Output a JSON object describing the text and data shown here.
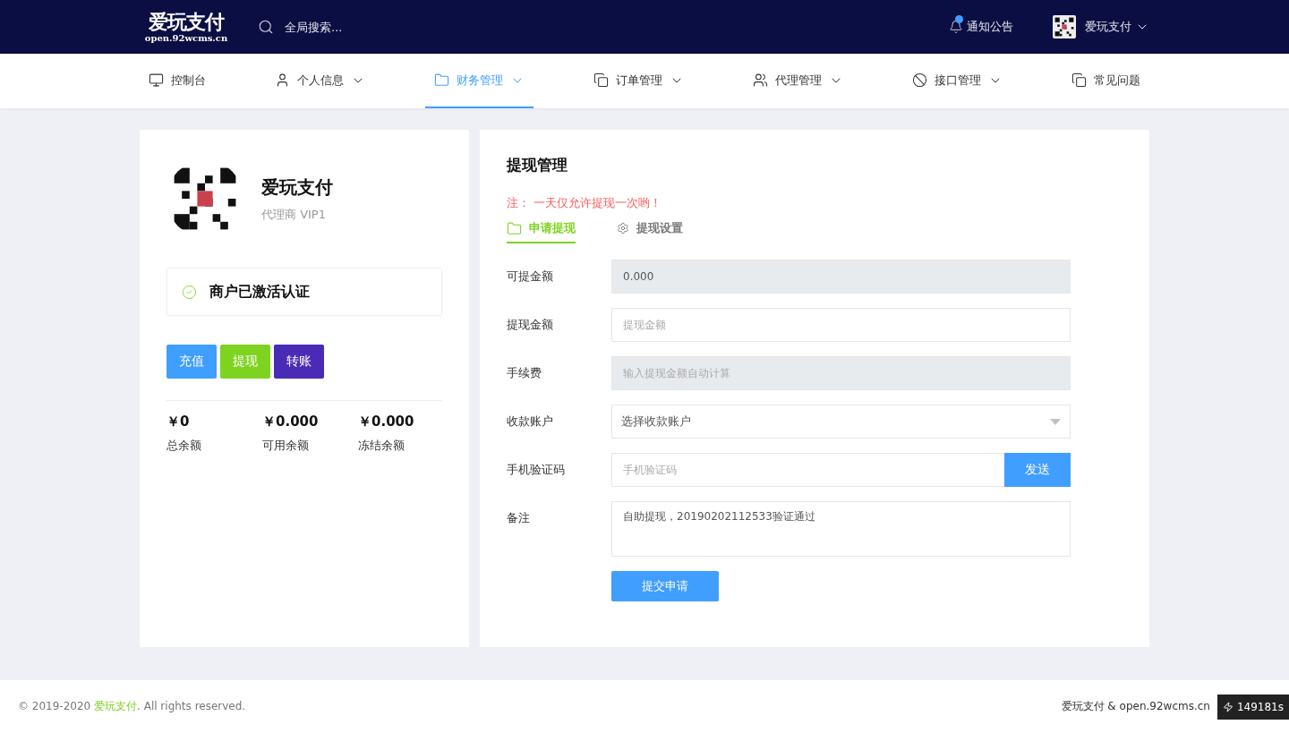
{
  "header": {
    "logo_title": "爱玩支付",
    "logo_domain": "open.92wcms.cn",
    "search": {
      "placeholder": "全局搜索..."
    },
    "notice": {
      "label": "通知公告",
      "unread": true
    },
    "user": {
      "name": "爱玩支付"
    }
  },
  "nav": [
    {
      "label": "控制台",
      "dropdown": false,
      "selected": false
    },
    {
      "label": "个人信息",
      "dropdown": true,
      "selected": false
    },
    {
      "label": "财务管理",
      "dropdown": true,
      "selected": true
    },
    {
      "label": "订单管理",
      "dropdown": true,
      "selected": false
    },
    {
      "label": "代理管理",
      "dropdown": true,
      "selected": false
    },
    {
      "label": "接口管理",
      "dropdown": true,
      "selected": false
    },
    {
      "label": "常见问题",
      "dropdown": false,
      "selected": false
    }
  ],
  "profile": {
    "name": "爱玩支付",
    "role": "代理商 VIP1",
    "status": "商户已激活认证",
    "verified": true,
    "actions": [
      {
        "label": "充值",
        "color": "#409eff"
      },
      {
        "label": "提现",
        "color": "#7ed321"
      },
      {
        "label": "转账",
        "color": "#4a2bb5"
      }
    ],
    "balances": [
      {
        "amount": "￥0",
        "label": "总余额"
      },
      {
        "amount": "￥0.000",
        "label": "可用余额"
      },
      {
        "amount": "￥0.000",
        "label": "冻结余额"
      }
    ]
  },
  "withdraw": {
    "title": "提现管理",
    "note": "注： 一天仅允许提现一次哟！",
    "tabs": [
      {
        "label": "申请提现",
        "selected": true
      },
      {
        "label": "提现设置",
        "selected": false
      }
    ],
    "fields": [
      {
        "kind": "readonly",
        "label": "可提金额",
        "value": "0.000"
      },
      {
        "kind": "input",
        "label": "提现金额",
        "placeholder": "提现金额"
      },
      {
        "kind": "disabled",
        "label": "手续费",
        "placeholder": "输入提现金额自动计算"
      },
      {
        "kind": "select",
        "label": "收款账户",
        "value": "选择收款账户"
      },
      {
        "kind": "code",
        "label": "手机验证码",
        "placeholder": "手机验证码",
        "button": "发送"
      },
      {
        "kind": "textarea",
        "label": "备注",
        "value": "自助提现，20190202112533验证通过"
      }
    ],
    "submit": "提交申请"
  },
  "footer": {
    "year": "© 2019-2020 ",
    "brand": "爱玩支付",
    "rights": ". All rights reserved.",
    "right": "爱玩支付 & open.92wcms.cn",
    "trace": "149181s"
  }
}
